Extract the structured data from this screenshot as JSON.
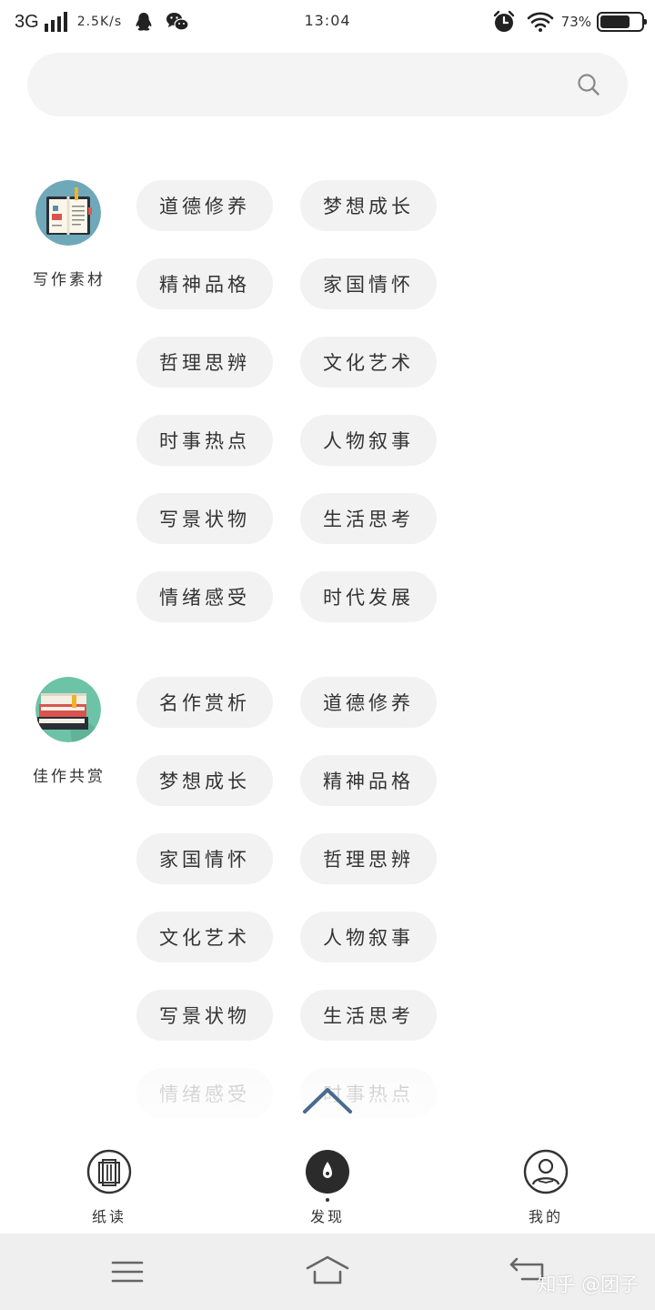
{
  "status_bar": {
    "network": "3G",
    "speed": "2.5K/s",
    "time": "13:04",
    "battery_percent": "73%",
    "battery_level": 0.73
  },
  "search": {
    "value": "",
    "placeholder": ""
  },
  "sections": [
    {
      "label": "写作素材",
      "icon": "notebook-icon",
      "tags": [
        "道德修养",
        "梦想成长",
        "精神品格",
        "家国情怀",
        "哲理思辨",
        "文化艺术",
        "时事热点",
        "人物叙事",
        "写景状物",
        "生活思考",
        "情绪感受",
        "时代发展"
      ]
    },
    {
      "label": "佳作共赏",
      "icon": "books-stack-icon",
      "tags": [
        "名作赏析",
        "道德修养",
        "梦想成长",
        "精神品格",
        "家国情怀",
        "哲理思辨",
        "文化艺术",
        "人物叙事",
        "写景状物",
        "生活思考",
        "情绪感受",
        "时事热点"
      ]
    }
  ],
  "bottom_nav": {
    "items": [
      {
        "label": "纸读",
        "icon": "paper-read-icon"
      },
      {
        "label": "发现",
        "icon": "compass-icon",
        "active": true
      },
      {
        "label": "我的",
        "icon": "profile-icon"
      }
    ]
  },
  "watermark": "知乎 @团子",
  "colors": {
    "tag_bg": "#f2f2f2",
    "search_bg": "#f4f4f4",
    "accent_chevron": "#4a6a8f",
    "system_nav_bg": "#efefef"
  }
}
